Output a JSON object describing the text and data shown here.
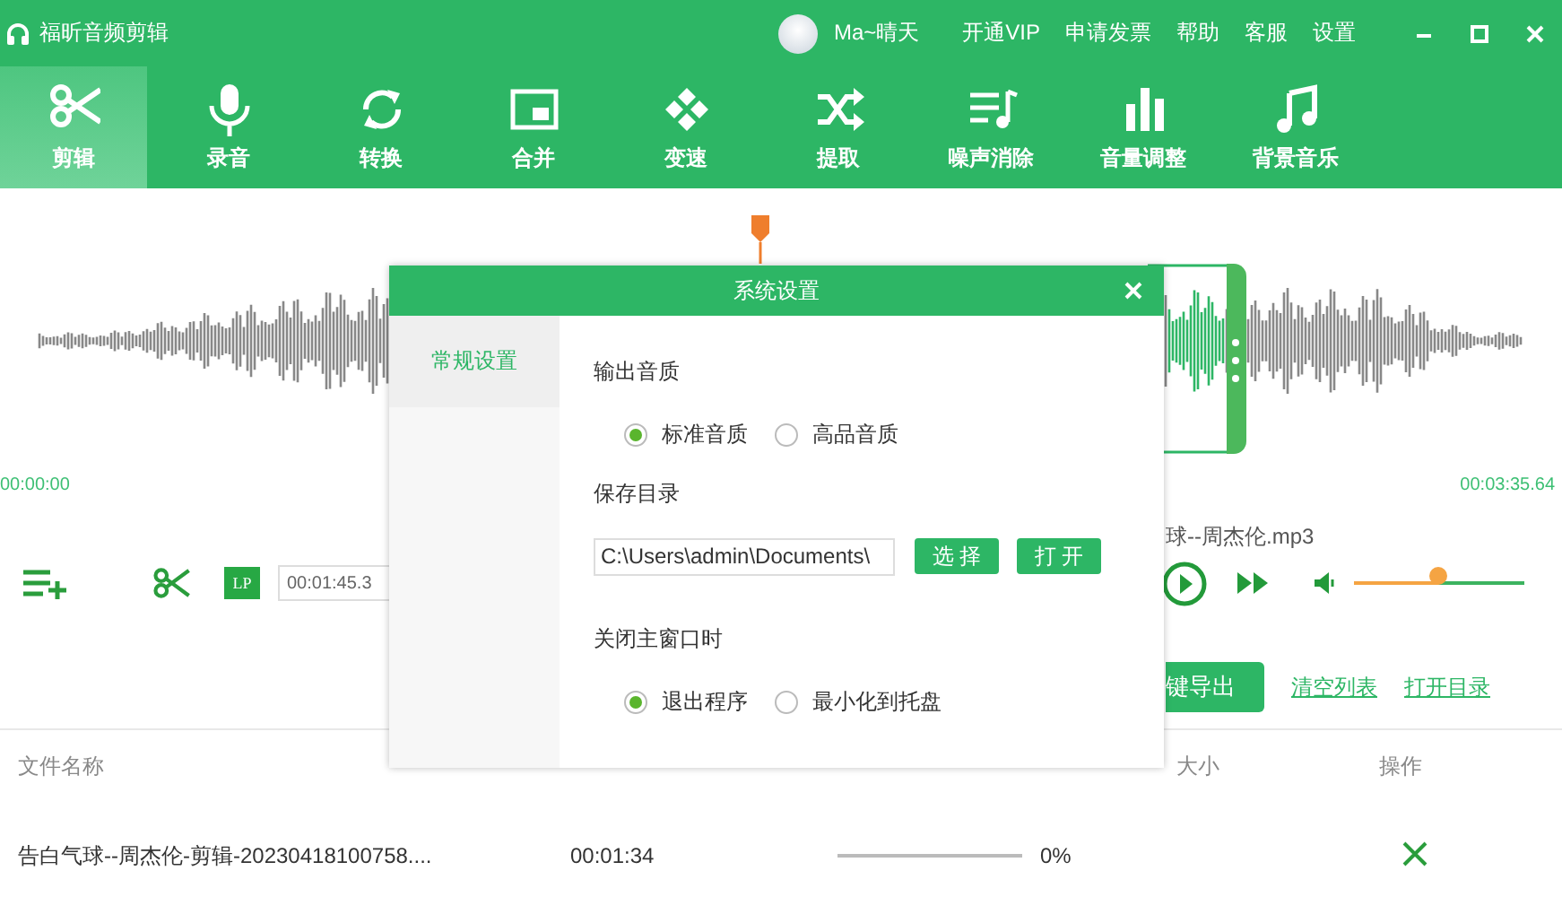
{
  "app": {
    "title": "福昕音频剪辑"
  },
  "user": {
    "name": "Ma~晴天"
  },
  "menu": [
    "开通VIP",
    "申请发票",
    "帮助",
    "客服",
    "设置"
  ],
  "tools": [
    {
      "label": "剪辑",
      "selected": true
    },
    {
      "label": "录音",
      "selected": false
    },
    {
      "label": "转换",
      "selected": false
    },
    {
      "label": "合并",
      "selected": false
    },
    {
      "label": "变速",
      "selected": false
    },
    {
      "label": "提取",
      "selected": false
    },
    {
      "label": "噪声消除",
      "selected": false
    },
    {
      "label": "音量调整",
      "selected": false
    },
    {
      "label": "背景音乐",
      "selected": false
    }
  ],
  "timeline": {
    "start": "00:00:00",
    "end": "00:03:35.64"
  },
  "player": {
    "file": "球--周杰伦.mp3",
    "badge": "LP",
    "position": "00:01:45.3",
    "volume": {
      "level": 0.49
    }
  },
  "actions": {
    "export": "键导出",
    "links": [
      "清空列表",
      "打开目录"
    ]
  },
  "table": {
    "columns": [
      {
        "kind": "name",
        "label": "文件名称"
      },
      {
        "kind": "size",
        "label": "大小"
      },
      {
        "kind": "action",
        "label": "操作"
      }
    ],
    "rows": [
      {
        "file": "告白气球--周杰伦-剪辑-20230418100758....",
        "duration": "00:01:34",
        "level": 0,
        "percent": "0%"
      }
    ]
  },
  "dialog": {
    "title": "系统设置",
    "nav": [
      {
        "label": "常规设置",
        "selected": true
      }
    ],
    "sections": [
      {
        "kind": "radios",
        "label": "输出音质",
        "options": [
          {
            "label": "标准音质",
            "selected": true
          },
          {
            "label": "高品音质",
            "selected": false
          }
        ]
      },
      {
        "kind": "folder",
        "label": "保存目录",
        "value": "C:\\Users\\admin\\Documents\\",
        "buttons": [
          "选 择",
          "打 开"
        ]
      },
      {
        "kind": "radios",
        "label": "关闭主窗口时",
        "options": [
          {
            "label": "退出程序",
            "selected": true
          },
          {
            "label": "最小化到托盘",
            "selected": false
          }
        ]
      }
    ]
  }
}
